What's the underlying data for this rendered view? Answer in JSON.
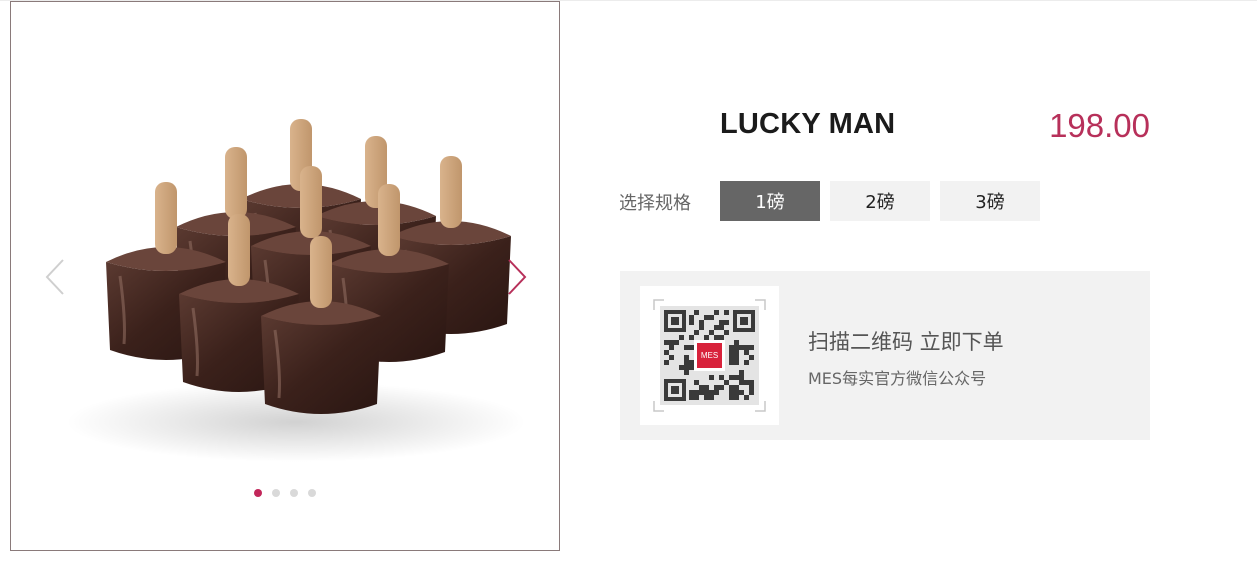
{
  "carousel": {
    "prev_icon": "chevron-left-icon",
    "next_icon": "chevron-right-icon",
    "slide_count": 4,
    "active_index": 0,
    "accent_color": "#c2275a"
  },
  "product": {
    "name": "LUCKY MAN",
    "price": "198.00",
    "price_color": "#b7305a"
  },
  "spec": {
    "label": "选择规格",
    "options": [
      {
        "label": "1磅",
        "selected": true
      },
      {
        "label": "2磅",
        "selected": false
      },
      {
        "label": "3磅",
        "selected": false
      }
    ]
  },
  "qr": {
    "logo_text": "MES",
    "title": "扫描二维码 立即下单",
    "subtitle": "MES每实官方微信公众号"
  }
}
